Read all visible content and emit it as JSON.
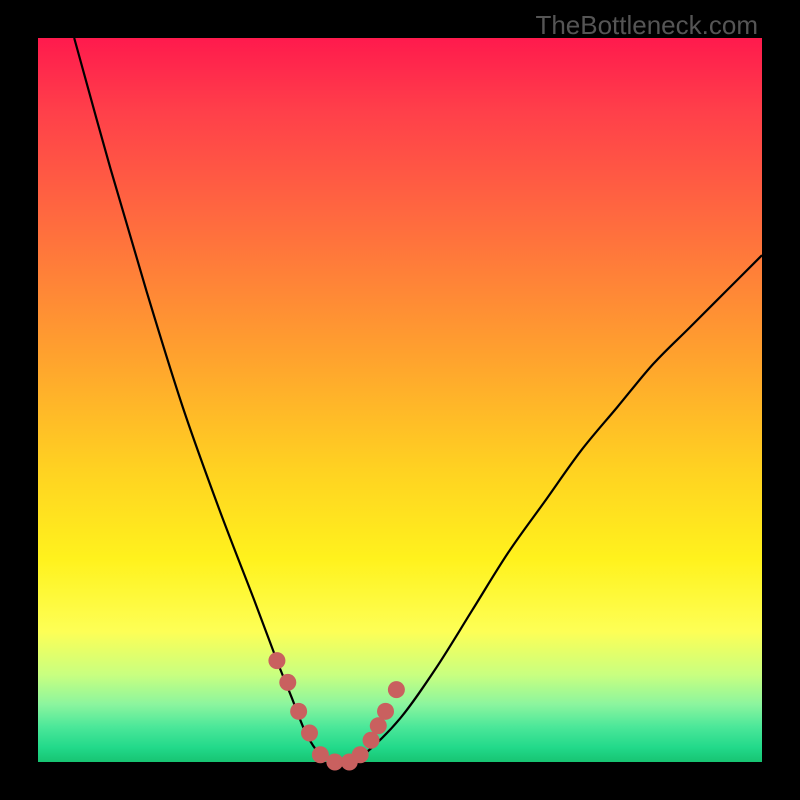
{
  "watermark": "TheBottleneck.com",
  "colors": {
    "background": "#000000",
    "curve": "#000000",
    "marker": "#c9605f",
    "gradient_top": "#ff1a4d",
    "gradient_mid": "#fff21d",
    "gradient_bottom": "#17c472"
  },
  "chart_data": {
    "type": "line",
    "title": "",
    "xlabel": "",
    "ylabel": "",
    "xlim": [
      0,
      100
    ],
    "ylim": [
      0,
      100
    ],
    "grid": false,
    "legend": "none",
    "series": [
      {
        "name": "bottleneck-curve",
        "x": [
          5,
          10,
          15,
          20,
          25,
          30,
          33,
          35,
          37,
          39,
          41,
          43,
          45,
          50,
          55,
          60,
          65,
          70,
          75,
          80,
          85,
          90,
          95,
          100
        ],
        "values": [
          100,
          82,
          65,
          49,
          35,
          22,
          14,
          9,
          4,
          1,
          0,
          0,
          1,
          6,
          13,
          21,
          29,
          36,
          43,
          49,
          55,
          60,
          65,
          70
        ]
      }
    ],
    "markers": {
      "name": "highlight-points",
      "x": [
        33,
        34.5,
        36,
        37.5,
        39,
        41,
        43,
        44.5,
        46,
        47,
        48,
        49.5
      ],
      "values": [
        14,
        11,
        7,
        4,
        1,
        0,
        0,
        1,
        3,
        5,
        7,
        10
      ]
    }
  }
}
